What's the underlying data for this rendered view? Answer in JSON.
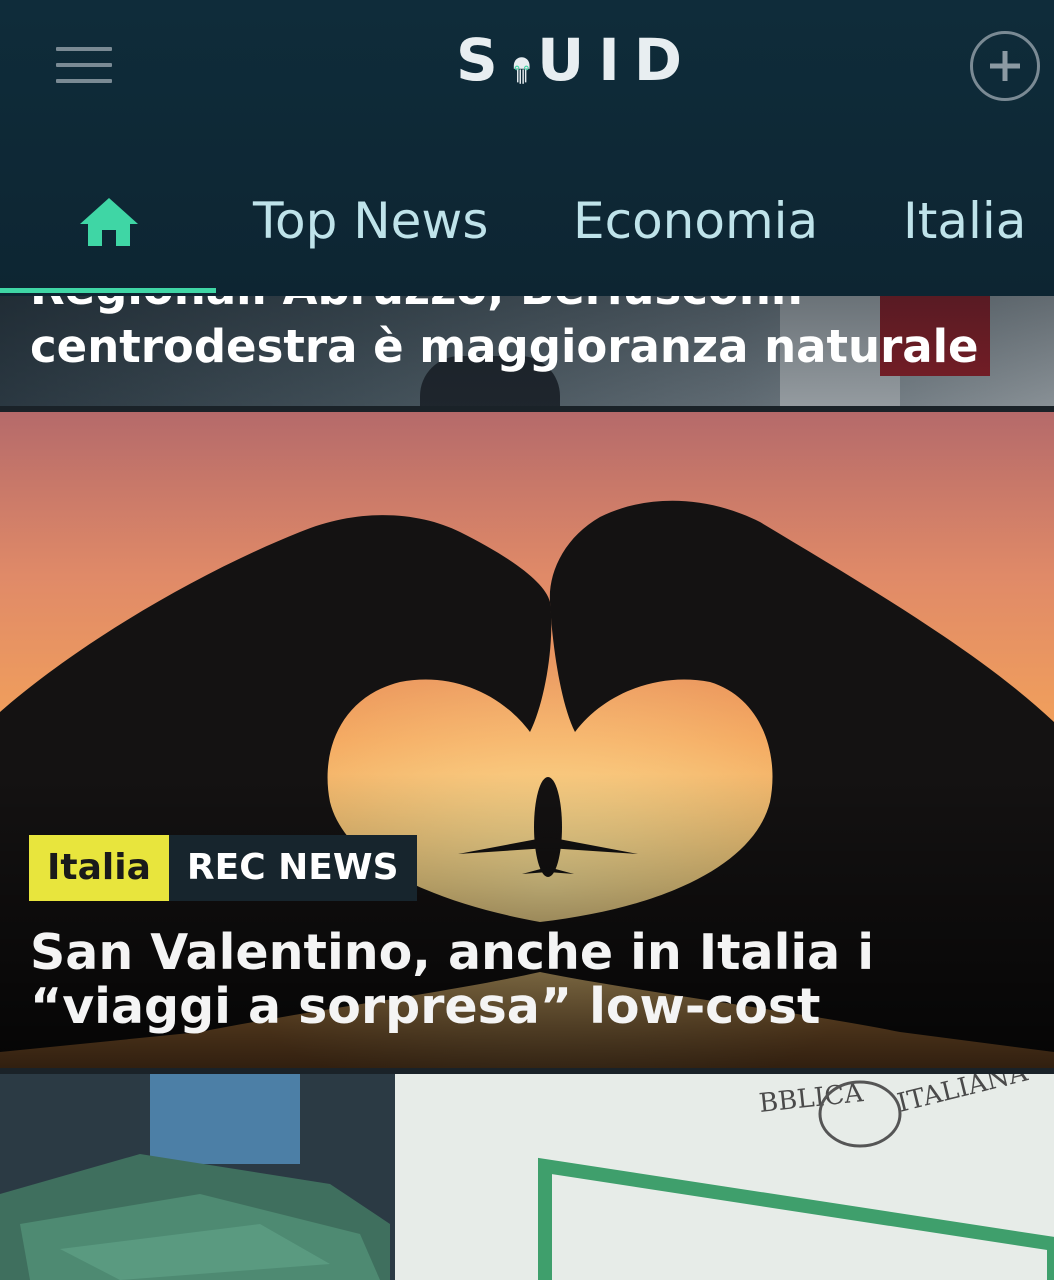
{
  "header": {
    "logo_text": "SQUID",
    "menu_icon": "hamburger-menu-icon",
    "add_icon": "plus-circle-icon"
  },
  "tabs": [
    {
      "icon": "home-icon",
      "active": true
    },
    {
      "label": "Top News"
    },
    {
      "label": "Economia"
    },
    {
      "label": "Italia"
    }
  ],
  "colors": {
    "header_bg": "#0f2c3a",
    "accent": "#3fd6a5",
    "tab_text": "#bfe3ea",
    "category_badge": "#e8e53d"
  },
  "feed": {
    "article1": {
      "title_line1": "Regionali Abruzzo, Berlusconi:",
      "title_line2": "centrodestra è maggioranza naturale"
    },
    "article2": {
      "category": "Italia",
      "source": "REC NEWS",
      "title": "San Valentino, anche in Italia i “viaggi a sorpresa” low-cost"
    },
    "article3": {
      "image_text_1": "BBLICA",
      "image_text_2": "ITALIANA"
    }
  }
}
